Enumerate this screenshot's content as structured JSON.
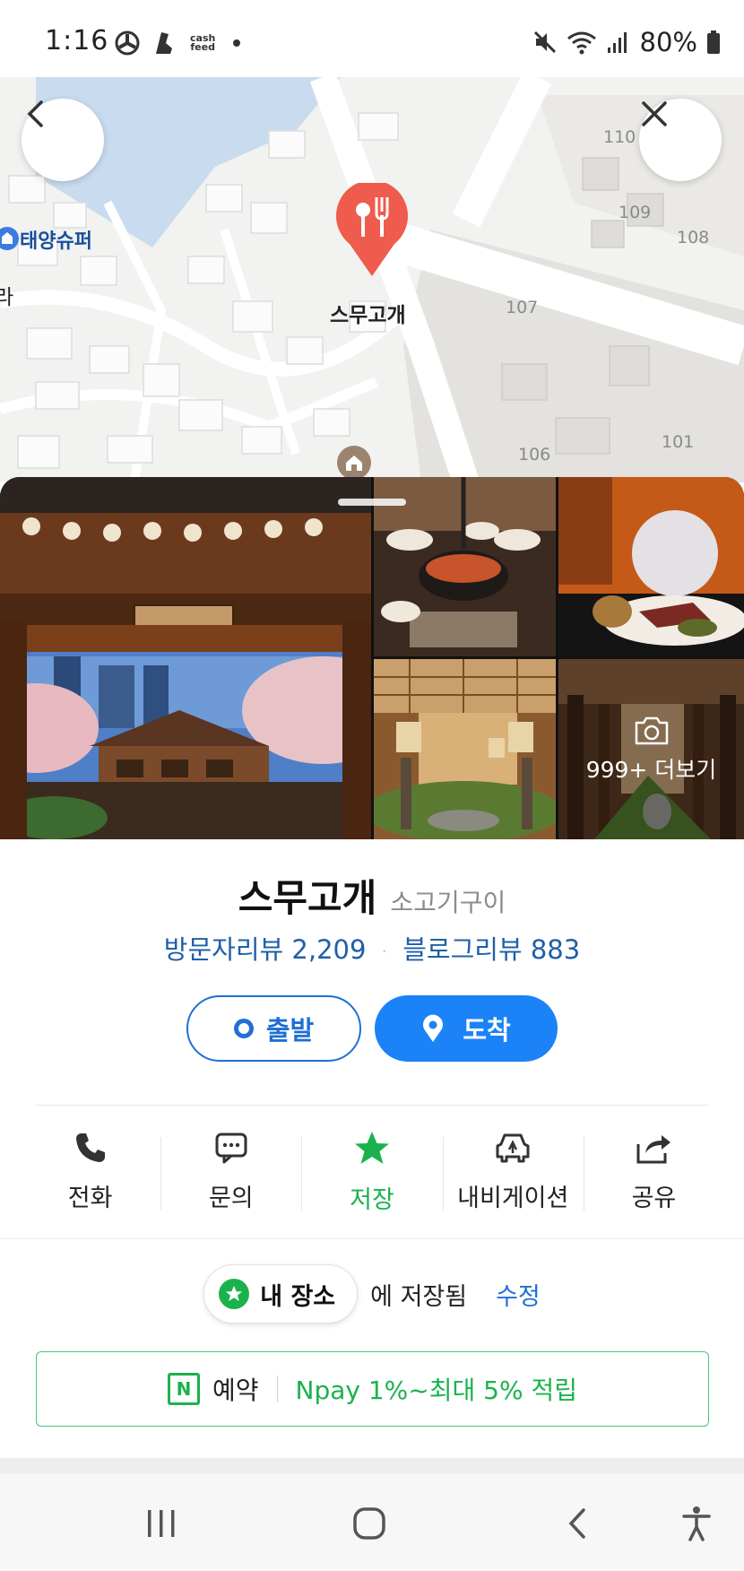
{
  "status_bar": {
    "time": "1:16",
    "cash_feed_line1": "cash",
    "cash_feed_line2": "feed",
    "battery": "80%"
  },
  "map": {
    "place_marker_label": "스무고개",
    "poi_label": "태양슈퍼",
    "edge_label": "라",
    "building_numbers": [
      "110",
      "109",
      "108",
      "107",
      "106",
      "101"
    ]
  },
  "photos": {
    "more_label": "999+ 더보기"
  },
  "place": {
    "name": "스무고개",
    "category": "소고기구이",
    "visitor_reviews": "방문자리뷰 2,209",
    "blog_reviews": "블로그리뷰 883",
    "separator": "·"
  },
  "route": {
    "depart_label": "출발",
    "arrive_label": "도착"
  },
  "actions": [
    {
      "label": "전화",
      "icon": "phone-icon"
    },
    {
      "label": "문의",
      "icon": "chat-icon"
    },
    {
      "label": "저장",
      "icon": "star-icon"
    },
    {
      "label": "내비게이션",
      "icon": "navigation-car-icon"
    },
    {
      "label": "공유",
      "icon": "share-icon"
    }
  ],
  "saved": {
    "chip_label": "내 장소",
    "saved_text": "에 저장됨",
    "edit_label": "수정"
  },
  "reservation": {
    "icon_letter": "N",
    "label": "예약",
    "promo": "Npay 1%~최대 5% 적립"
  },
  "colors": {
    "accent_blue": "#1b82f7",
    "link_blue": "#1f5fa8",
    "green": "#1bb24d",
    "marker_red": "#ef5b4c"
  }
}
